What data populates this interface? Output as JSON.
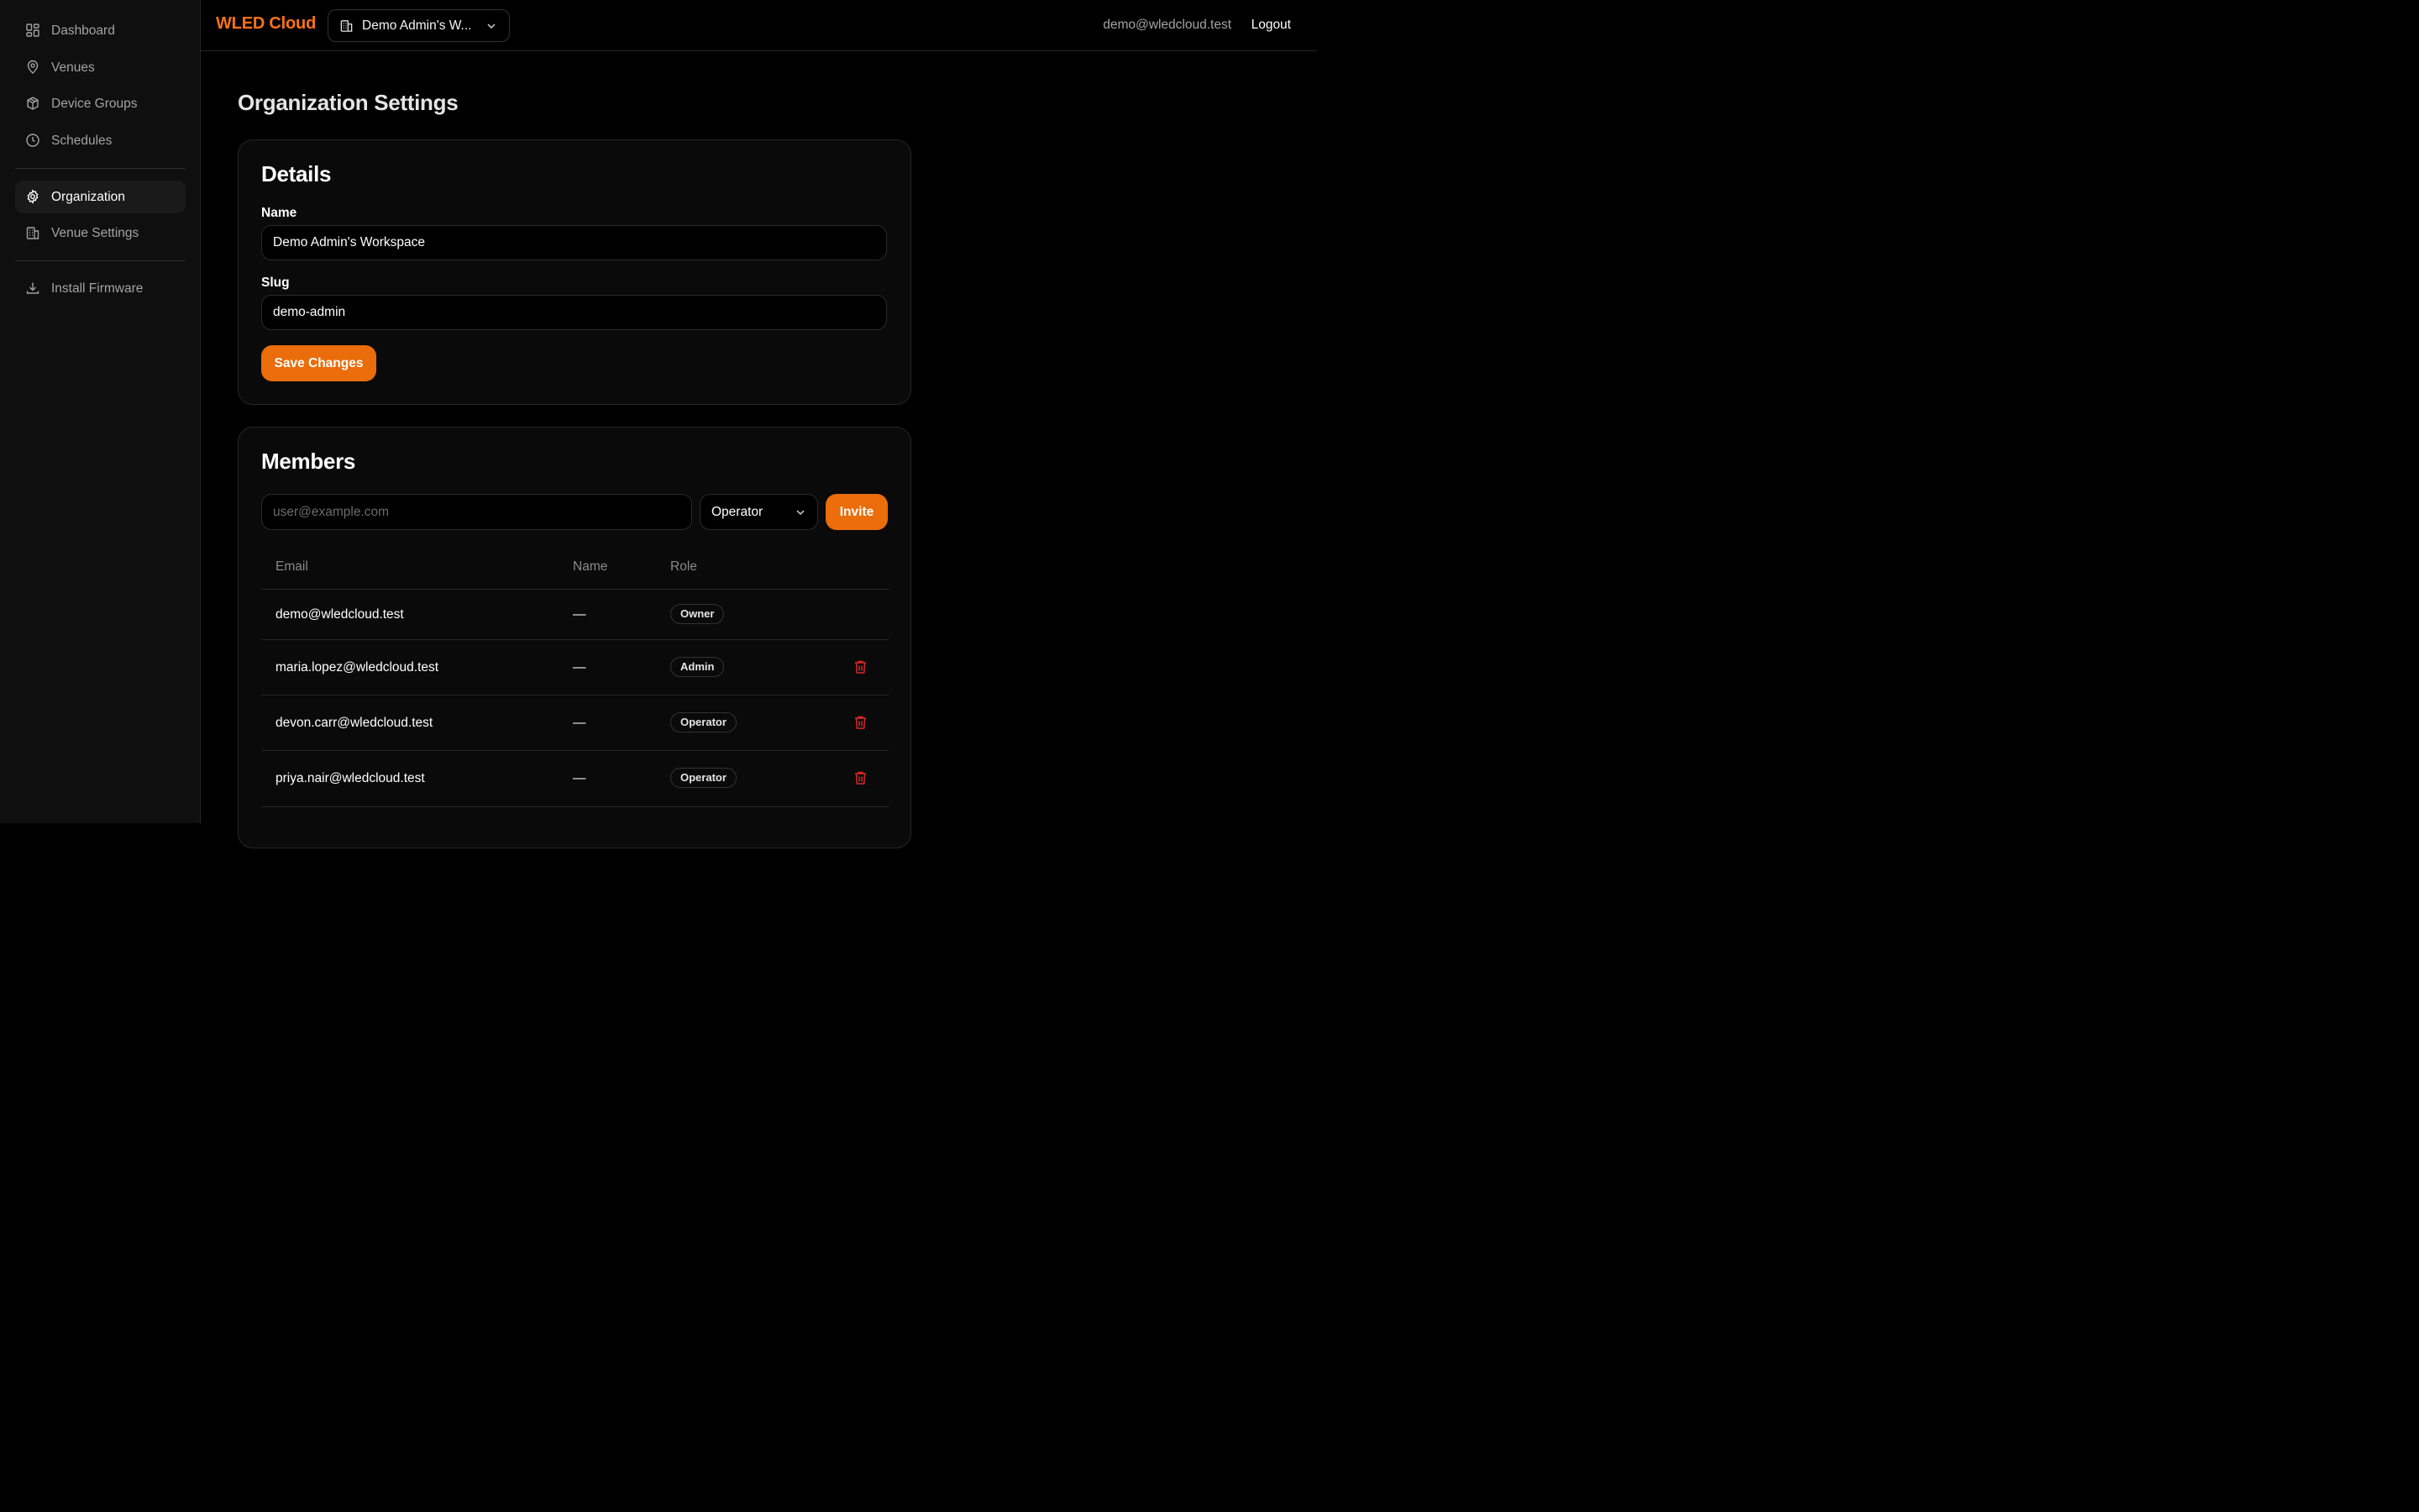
{
  "sidebar": {
    "items": [
      {
        "label": "Dashboard",
        "icon": "dashboard-icon"
      },
      {
        "label": "Venues",
        "icon": "map-pin-icon"
      },
      {
        "label": "Device Groups",
        "icon": "box-icon"
      },
      {
        "label": "Schedules",
        "icon": "clock-icon"
      },
      {
        "label": "Organization",
        "icon": "gear-icon",
        "active": true
      },
      {
        "label": "Venue Settings",
        "icon": "building-icon"
      },
      {
        "label": "Install Firmware",
        "icon": "download-icon"
      }
    ]
  },
  "header": {
    "brand": "WLED Cloud",
    "org_switcher": "Demo Admin's W...",
    "user_email": "demo@wledcloud.test",
    "logout_label": "Logout"
  },
  "page": {
    "title": "Organization Settings"
  },
  "details": {
    "title": "Details",
    "name_label": "Name",
    "name_value": "Demo Admin's Workspace",
    "slug_label": "Slug",
    "slug_value": "demo-admin",
    "save_label": "Save Changes"
  },
  "members": {
    "title": "Members",
    "invite_placeholder": "user@example.com",
    "role_selected": "Operator",
    "invite_label": "Invite",
    "columns": {
      "email": "Email",
      "name": "Name",
      "role": "Role"
    },
    "rows": [
      {
        "email": "demo@wledcloud.test",
        "name": "—",
        "role": "Owner"
      },
      {
        "email": "maria.lopez@wledcloud.test",
        "name": "—",
        "role": "Admin"
      },
      {
        "email": "devon.carr@wledcloud.test",
        "name": "—",
        "role": "Operator"
      },
      {
        "email": "priya.nair@wledcloud.test",
        "name": "—",
        "role": "Operator"
      }
    ]
  },
  "colors": {
    "accent": "#ea6c0a",
    "brand": "#f97316",
    "danger": "#dc2626",
    "background": "#000000"
  }
}
